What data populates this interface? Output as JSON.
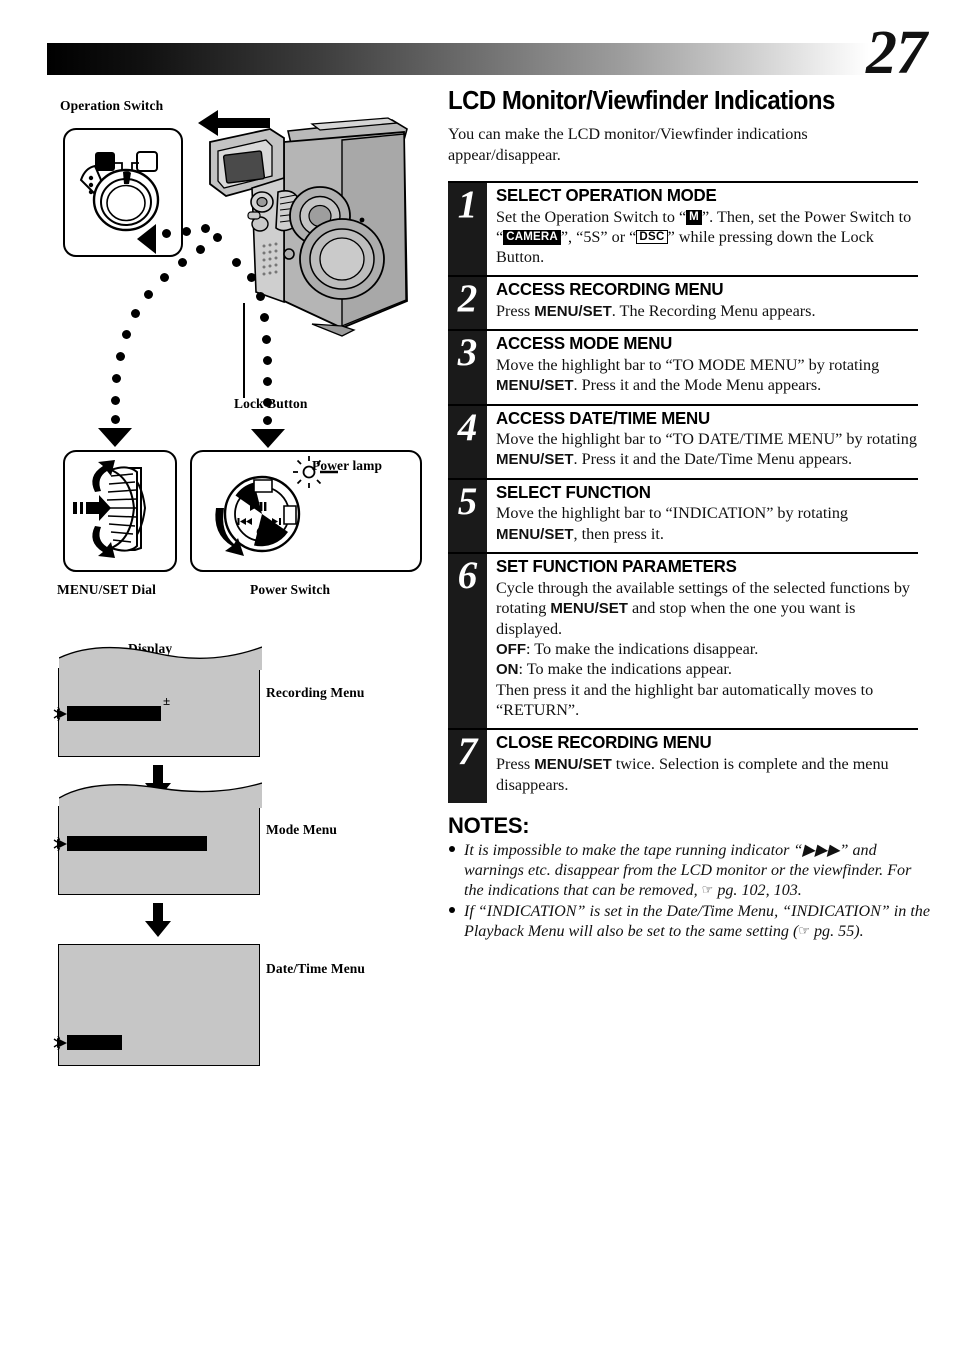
{
  "page": {
    "number": "27"
  },
  "illustrations": {
    "operation_switch_label": "Operation Switch",
    "lock_button_label": "Lock Button",
    "menuset_dial_label": "MENU/SET Dial",
    "power_switch_label": "Power Switch",
    "power_lamp_label": "Power lamp",
    "display_label": "Display",
    "screens": [
      {
        "name": "Recording Menu"
      },
      {
        "name": "Mode Menu"
      },
      {
        "name": "Date/Time Menu"
      }
    ]
  },
  "main": {
    "title": "LCD Monitor/Viewfinder Indications",
    "intro": "You can make the LCD monitor/Viewfinder indications appear/disappear.",
    "steps": [
      {
        "num": "1",
        "title": "SELECT OPERATION MODE",
        "body_parts": [
          {
            "t": "text",
            "v": "Set the Operation Switch to “"
          },
          {
            "t": "badge",
            "v": "M"
          },
          {
            "t": "text",
            "v": "”. Then, set the Power Switch to “"
          },
          {
            "t": "badge",
            "v": "CAMERA"
          },
          {
            "t": "text",
            "v": "”, “5S” or “"
          },
          {
            "t": "badge-outline",
            "v": "DSC"
          },
          {
            "t": "text",
            "v": "” while pressing down the Lock Button."
          }
        ]
      },
      {
        "num": "2",
        "title": "ACCESS RECORDING MENU",
        "body_parts": [
          {
            "t": "text",
            "v": "Press "
          },
          {
            "t": "bold",
            "v": "MENU/SET"
          },
          {
            "t": "text",
            "v": ". The Recording Menu appears."
          }
        ]
      },
      {
        "num": "3",
        "title": "ACCESS MODE MENU",
        "body_parts": [
          {
            "t": "text",
            "v": "Move the highlight bar to “TO MODE MENU” by rotating "
          },
          {
            "t": "bold",
            "v": "MENU/SET"
          },
          {
            "t": "text",
            "v": ". Press it and the Mode Menu appears."
          }
        ]
      },
      {
        "num": "4",
        "title": "ACCESS DATE/TIME MENU",
        "body_parts": [
          {
            "t": "text",
            "v": "Move the highlight bar to “TO DATE/TIME MENU” by rotating "
          },
          {
            "t": "bold",
            "v": "MENU/SET"
          },
          {
            "t": "text",
            "v": ". Press it and the Date/Time Menu appears."
          }
        ]
      },
      {
        "num": "5",
        "title": "SELECT FUNCTION",
        "body_parts": [
          {
            "t": "text",
            "v": "Move the highlight bar to “INDICATION” by rotating "
          },
          {
            "t": "bold",
            "v": "MENU/SET"
          },
          {
            "t": "text",
            "v": ", then press it."
          }
        ]
      },
      {
        "num": "6",
        "title": "SET FUNCTION PARAMETERS",
        "body_parts": [
          {
            "t": "text",
            "v": "Cycle through the available settings of the selected functions by rotating "
          },
          {
            "t": "bold",
            "v": "MENU/SET"
          },
          {
            "t": "text",
            "v": " and stop when the one you want is displayed."
          },
          {
            "t": "br"
          },
          {
            "t": "bold",
            "v": "OFF"
          },
          {
            "t": "text",
            "v": ": To make the indications disappear."
          },
          {
            "t": "br"
          },
          {
            "t": "bold",
            "v": "ON"
          },
          {
            "t": "text",
            "v": ": To make the indications appear."
          },
          {
            "t": "br"
          },
          {
            "t": "text",
            "v": "Then press it and the highlight bar automatically moves to “RETURN”."
          }
        ]
      },
      {
        "num": "7",
        "title": "CLOSE RECORDING MENU",
        "body_parts": [
          {
            "t": "text",
            "v": "Press "
          },
          {
            "t": "bold",
            "v": "MENU/SET"
          },
          {
            "t": "text",
            "v": " twice. Selection is complete and the menu disappears."
          }
        ]
      }
    ],
    "notes_title": "NOTES:",
    "notes": [
      {
        "parts": [
          {
            "t": "text",
            "v": "It is impossible to make the tape running indicator “▶▶▶” and warnings etc. disappear from the LCD monitor or the viewfinder. For the indications that can be removed, "
          },
          {
            "t": "hand",
            "v": "☞"
          },
          {
            "t": "text",
            "v": " pg. 102, 103."
          }
        ]
      },
      {
        "parts": [
          {
            "t": "text",
            "v": "If “INDICATION” is set in the Date/Time Menu, “INDICATION” in the Playback Menu will also be set to the same setting ("
          },
          {
            "t": "hand",
            "v": "☞"
          },
          {
            "t": "text",
            "v": " pg. 55)."
          }
        ]
      }
    ]
  },
  "colors": {
    "step_bar": "#1a1a1a",
    "screen_fill": "#c6c6c6",
    "ink": "#000000"
  }
}
